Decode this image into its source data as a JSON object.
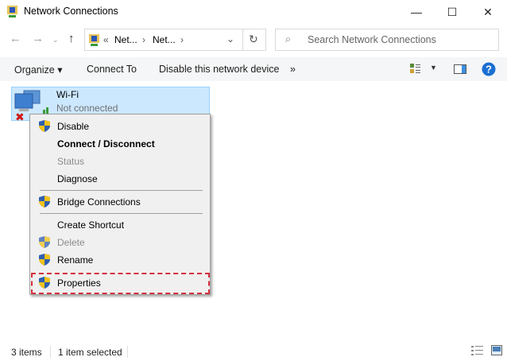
{
  "window": {
    "title": "Network Connections",
    "minimize_icon": "minimize-icon",
    "maximize_icon": "maximize-icon",
    "close_icon": "close-icon"
  },
  "address": {
    "prefix": "«",
    "crumbs": [
      "Net...",
      "Net..."
    ],
    "sep": "›"
  },
  "search": {
    "placeholder": "Search Network Connections"
  },
  "toolbar": {
    "organize": "Organize ▾",
    "connect_to": "Connect To",
    "disable_device": "Disable this network device",
    "more": "»"
  },
  "item": {
    "name": "Wi-Fi",
    "status": "Not connected"
  },
  "menu": {
    "disable": "Disable",
    "connect": "Connect / Disconnect",
    "status": "Status",
    "diagnose": "Diagnose",
    "bridge": "Bridge Connections",
    "shortcut": "Create Shortcut",
    "delete": "Delete",
    "rename": "Rename",
    "properties": "Properties"
  },
  "statusbar": {
    "count": "3 items",
    "selected": "1 item selected"
  },
  "colors": {
    "selection": "#cce8ff",
    "highlight": "#d32f3c",
    "help": "#1a6fd1"
  }
}
